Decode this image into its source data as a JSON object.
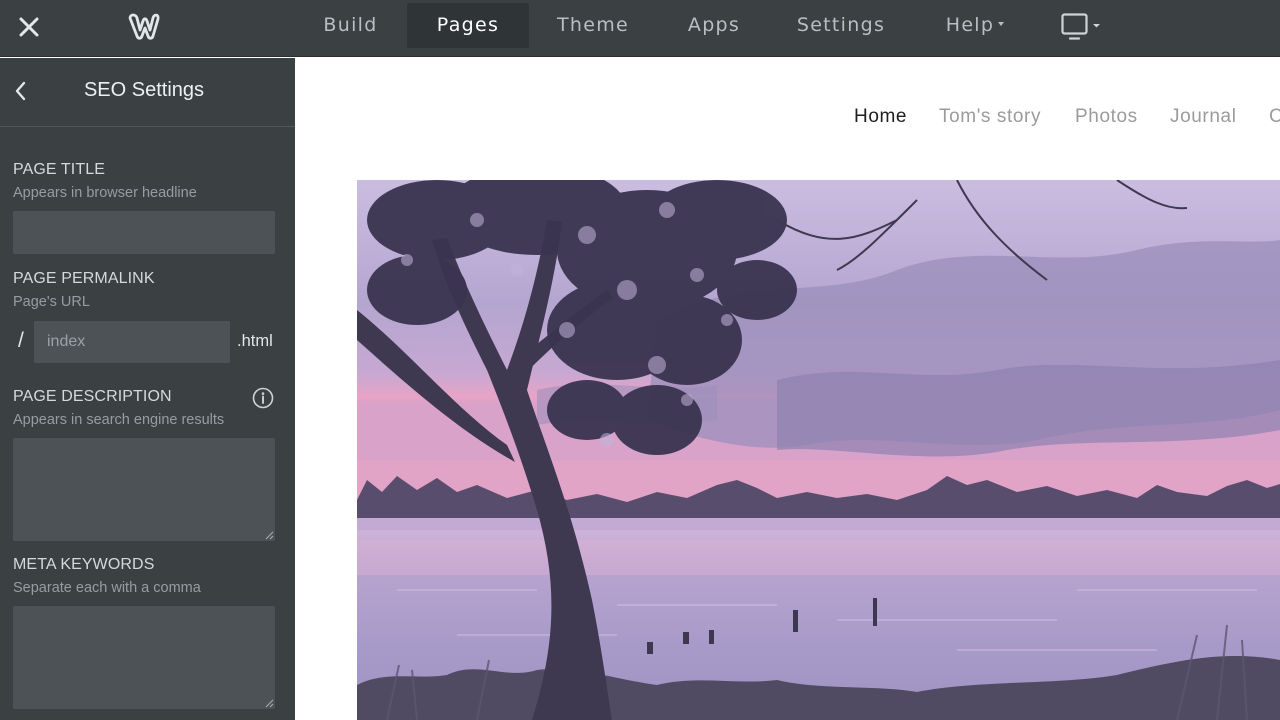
{
  "topbar": {
    "nav": [
      {
        "label": "Build",
        "active": false
      },
      {
        "label": "Pages",
        "active": true
      },
      {
        "label": "Theme",
        "active": false
      },
      {
        "label": "Apps",
        "active": false
      },
      {
        "label": "Settings",
        "active": false
      },
      {
        "label": "Help",
        "active": false,
        "dropdown": true
      }
    ],
    "icons": {
      "close": "close-icon",
      "logo": "weebly-logo-icon",
      "device": "desktop-monitor-icon"
    }
  },
  "panel": {
    "title": "SEO Settings",
    "page_title": {
      "label": "PAGE TITLE",
      "hint": "Appears in browser headline",
      "value": ""
    },
    "permalink": {
      "label": "PAGE PERMALINK",
      "hint": "Page's URL",
      "prefix": "/",
      "placeholder": "index",
      "value": "",
      "suffix": ".html"
    },
    "description": {
      "label": "PAGE DESCRIPTION",
      "hint": "Appears in search engine results",
      "value": ""
    },
    "keywords": {
      "label": "META KEYWORDS",
      "hint": "Separate each with a comma",
      "value": ""
    }
  },
  "site": {
    "nav": [
      {
        "label": "Home",
        "active": true
      },
      {
        "label": "Tom's story",
        "active": false
      },
      {
        "label": "Photos",
        "active": false
      },
      {
        "label": "Journal",
        "active": false
      },
      {
        "label": "C",
        "active": false
      }
    ]
  },
  "colors": {
    "panel_bg": "#3b4043",
    "input_bg": "#4d5256",
    "active_tab_bg": "#2f3437",
    "sky_top": "#c4b3d9",
    "sky_horizon": "#e6a2c5",
    "water": "#a895c2"
  }
}
